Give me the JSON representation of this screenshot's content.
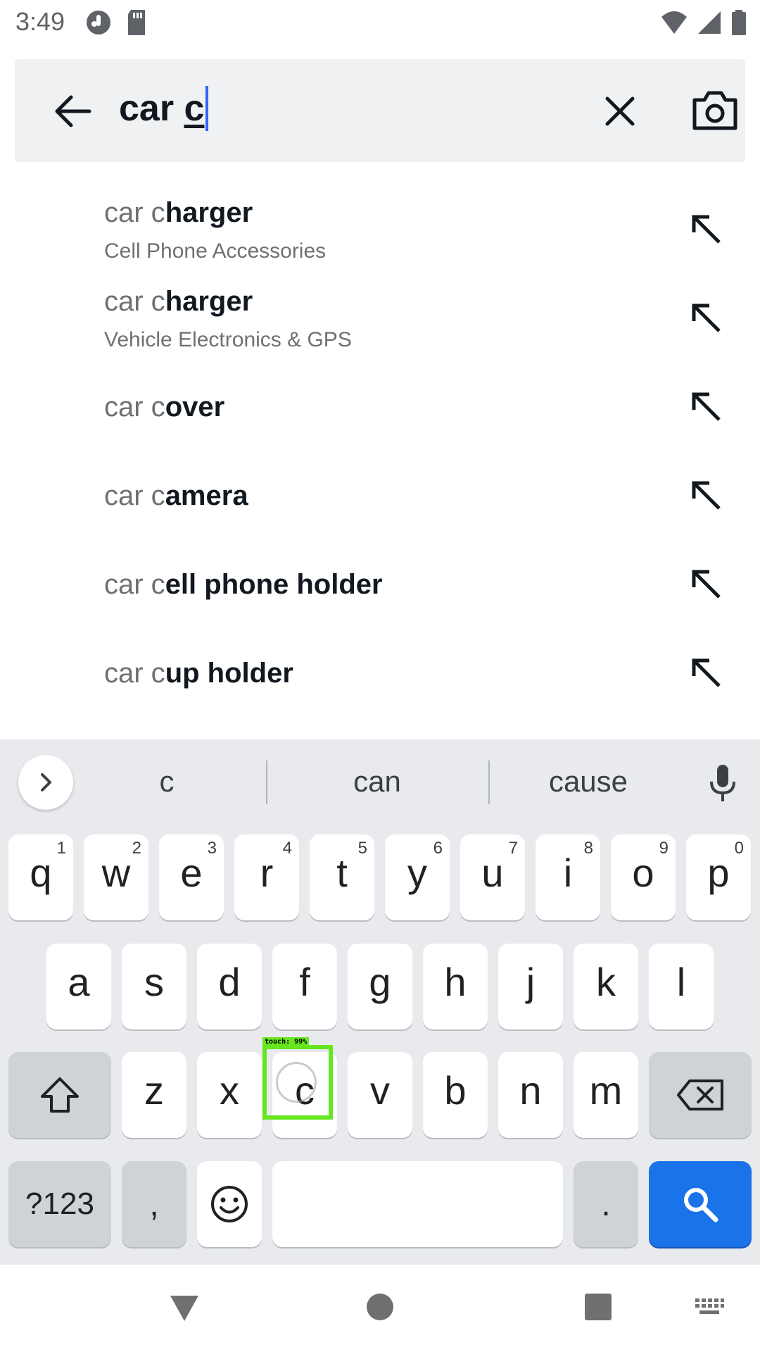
{
  "status_bar": {
    "time": "3:49",
    "left_icons": [
      "app-notification-icon",
      "sd-card-icon"
    ],
    "right_icons": [
      "wifi-icon",
      "signal-icon",
      "battery-icon"
    ]
  },
  "search": {
    "query_prefix": "car ",
    "query_typed": "c",
    "back_icon": "arrow-left-icon",
    "clear_icon": "close-icon",
    "camera_icon": "camera-icon"
  },
  "suggestions": [
    {
      "prefix": "car c",
      "completion": "harger",
      "category": "Cell Phone Accessories"
    },
    {
      "prefix": "car c",
      "completion": "harger",
      "category": "Vehicle Electronics & GPS"
    },
    {
      "prefix": "car c",
      "completion": "over",
      "category": ""
    },
    {
      "prefix": "car c",
      "completion": "amera",
      "category": ""
    },
    {
      "prefix": "car c",
      "completion": "ell phone holder",
      "category": ""
    },
    {
      "prefix": "car c",
      "completion": "up holder",
      "category": ""
    }
  ],
  "keyboard": {
    "word_suggestions": [
      "c",
      "can",
      "cause"
    ],
    "row1": [
      {
        "key": "q",
        "hint": "1"
      },
      {
        "key": "w",
        "hint": "2"
      },
      {
        "key": "e",
        "hint": "3"
      },
      {
        "key": "r",
        "hint": "4"
      },
      {
        "key": "t",
        "hint": "5"
      },
      {
        "key": "y",
        "hint": "6"
      },
      {
        "key": "u",
        "hint": "7"
      },
      {
        "key": "i",
        "hint": "8"
      },
      {
        "key": "o",
        "hint": "9"
      },
      {
        "key": "p",
        "hint": "0"
      }
    ],
    "row2": [
      "a",
      "s",
      "d",
      "f",
      "g",
      "h",
      "j",
      "k",
      "l"
    ],
    "row3": [
      "z",
      "x",
      "c",
      "v",
      "b",
      "n",
      "m"
    ],
    "symbols_label": "?123",
    "comma_label": ",",
    "period_label": ".",
    "accent_color": "#1a73e8"
  },
  "touch_indicator": {
    "label": "touch: 99%",
    "color": "#66e61e"
  },
  "nav_bar": {
    "buttons": [
      "back-triangle-icon",
      "home-circle-icon",
      "recents-square-icon",
      "keyboard-switch-icon"
    ]
  }
}
